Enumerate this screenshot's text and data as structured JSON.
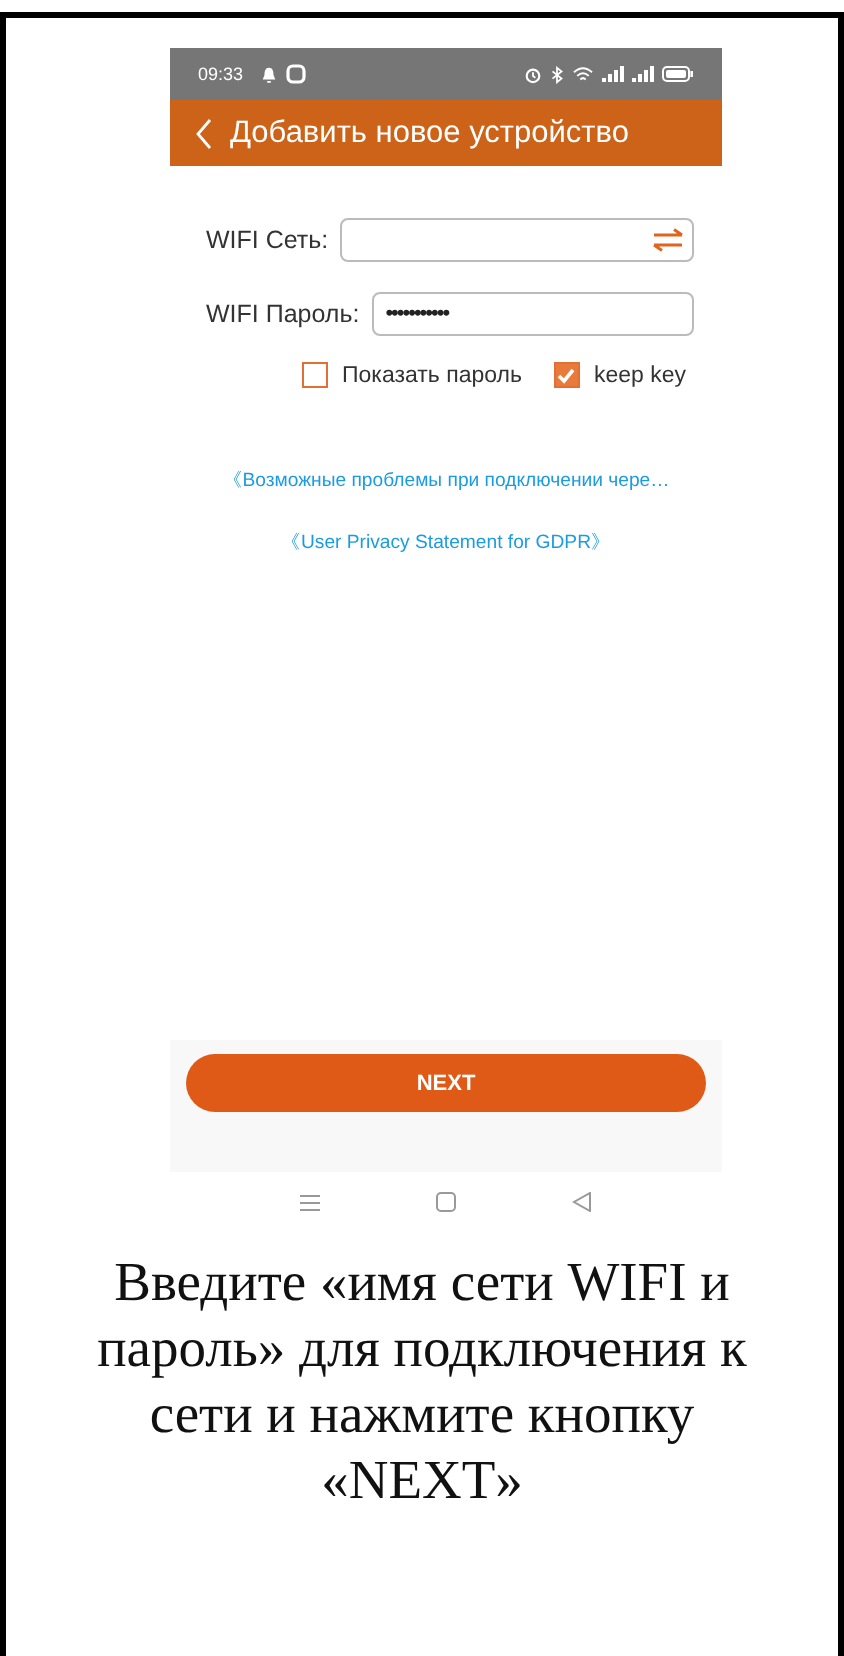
{
  "status_bar": {
    "time": "09:33"
  },
  "header": {
    "title": "Добавить новое устройство"
  },
  "form": {
    "fields": [
      {
        "label": "WIFI Сеть:",
        "kind": "select"
      },
      {
        "label": "WIFI Пароль:",
        "value": "•••••••••••",
        "kind": "password"
      }
    ],
    "checkboxes": [
      {
        "label": "Показать пароль",
        "checked": false
      },
      {
        "label": "keep key",
        "checked": true
      }
    ]
  },
  "links": [
    "《Возможные проблемы при подключении чере…",
    "《User Privacy Statement for GDPR》"
  ],
  "button": "NEXT",
  "caption": "Введите «имя сети WIFI и пароль» для подключения к сети и нажмите кнопку «NEXT»"
}
